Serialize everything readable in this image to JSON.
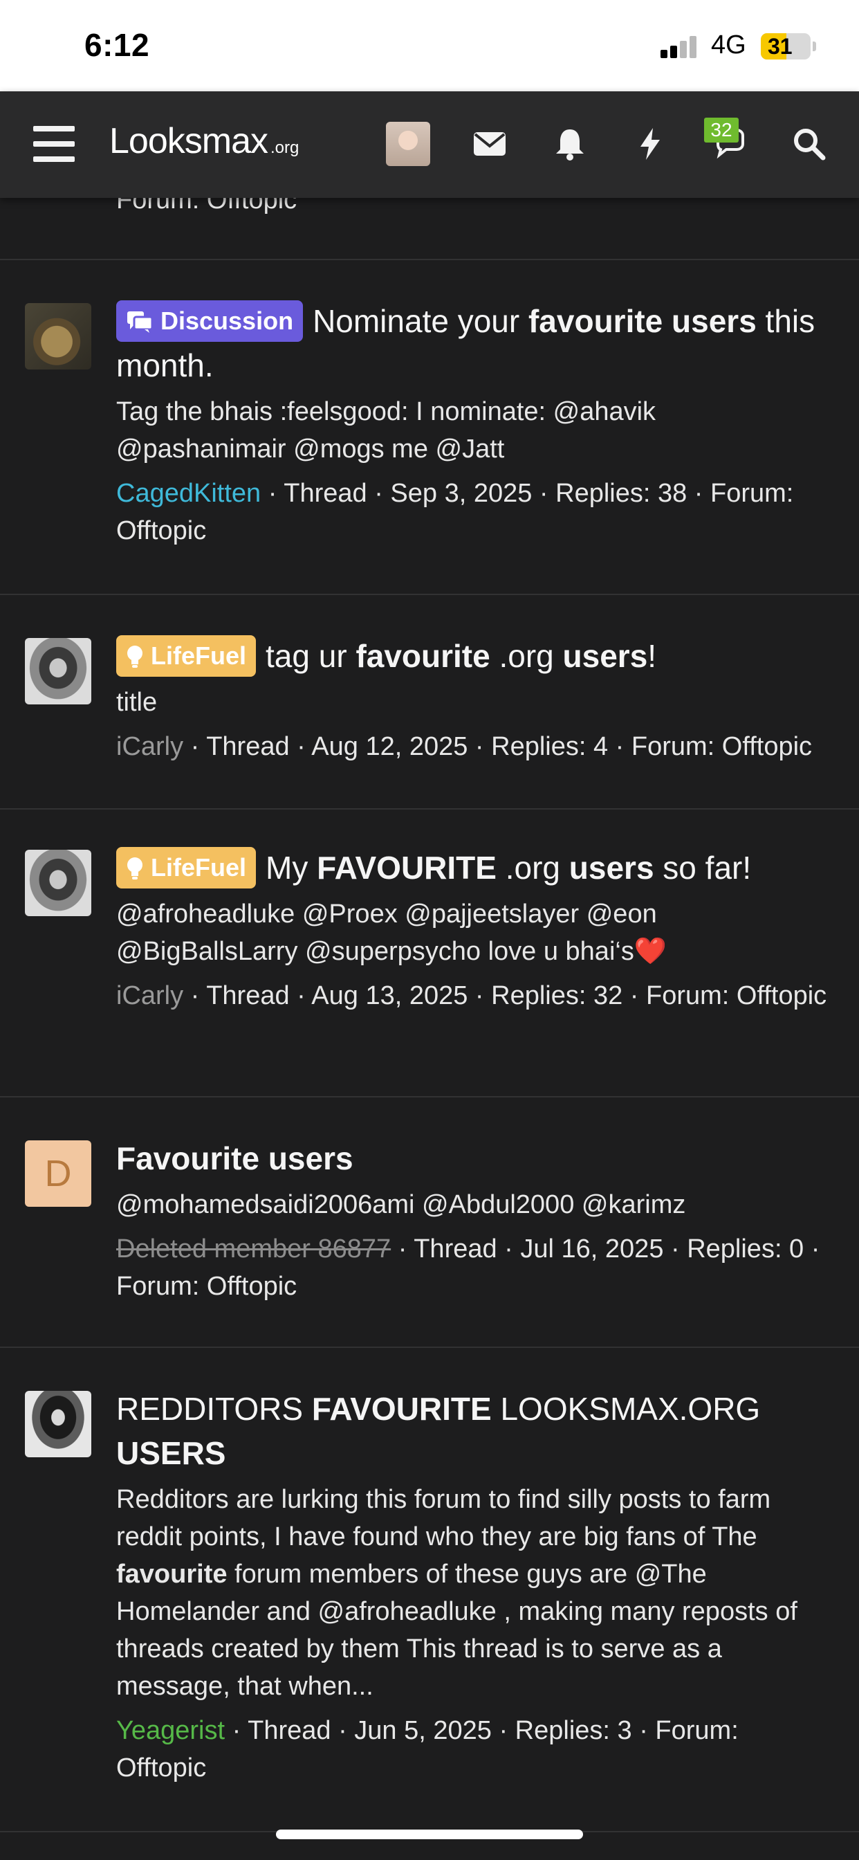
{
  "status_bar": {
    "time": "6:12",
    "network": "4G",
    "battery": "31"
  },
  "navbar": {
    "logo_main": "Looksmax",
    "logo_suffix": ".org",
    "icons": [
      "menu-icon",
      "avatar",
      "envelope-icon",
      "bell-icon",
      "lightning-icon",
      "chat-bubbles-icon",
      "search-icon"
    ],
    "chat_badge": "32"
  },
  "partial_row": {
    "meta": "Forum: Offtopic"
  },
  "results": [
    {
      "prefix": "Discussion",
      "title_parts": [
        "",
        "Nominate your ",
        "favourite users",
        " this month."
      ],
      "snippet": "Tag the bhais :feelsgood: I nominate: @ahavik @pashanimair @mogs me @Jatt",
      "author": "CagedKitten",
      "author_color": "#3fb9d9",
      "meta": " · Thread · Sep 3, 2025 · Replies: 38 · Forum: Offtopic"
    },
    {
      "prefix": "LifeFuel",
      "title_parts": [
        "tag ur ",
        "favourite",
        " .org ",
        "users",
        "!"
      ],
      "snippet": "title",
      "author": "iCarly",
      "author_color": "#9a9a9a",
      "meta": " · Thread · Aug 12, 2025 · Replies: 4 · Forum: Offtopic"
    },
    {
      "prefix": "LifeFuel",
      "title_parts": [
        "My ",
        "FAVOURITE",
        " .org ",
        "users",
        " so far!"
      ],
      "snippet": "@afroheadluke @Proex @pajjeetslayer @eon @BigBallsLarry @superpsycho love u bhai‘s",
      "snippet_emoji": "❤️",
      "author": "iCarly",
      "author_color": "#9a9a9a",
      "meta": " · Thread · Aug 13, 2025 · Replies: 32 · Forum: Offtopic"
    },
    {
      "prefix": "",
      "title": "Favourite users",
      "avatar_letter": "D",
      "snippet": "@mohamedsaidi2006ami @Abdul2000 @karimz",
      "author": "Deleted member 86877",
      "meta": " · Thread · Jul 16, 2025 · Replies: 0 · Forum: Offtopic"
    },
    {
      "prefix": "",
      "title_parts": [
        "REDDITORS ",
        "FAVOURITE",
        " LOOKSMAX.ORG ",
        "USERS"
      ],
      "snippet_parts": [
        "Redditors are lurking this forum to find silly posts to farm reddit points, I have found who they are big fans of The ",
        "favourite",
        " forum members of these guys are @The Homelander and @afroheadluke , making many reposts of threads created by them This thread is to serve as a message, that when..."
      ],
      "author": "Yeagerist",
      "author_color": "#56b948",
      "meta": " · Thread · Jun 5, 2025 · Replies: 3 · Forum: Offtopic"
    }
  ]
}
